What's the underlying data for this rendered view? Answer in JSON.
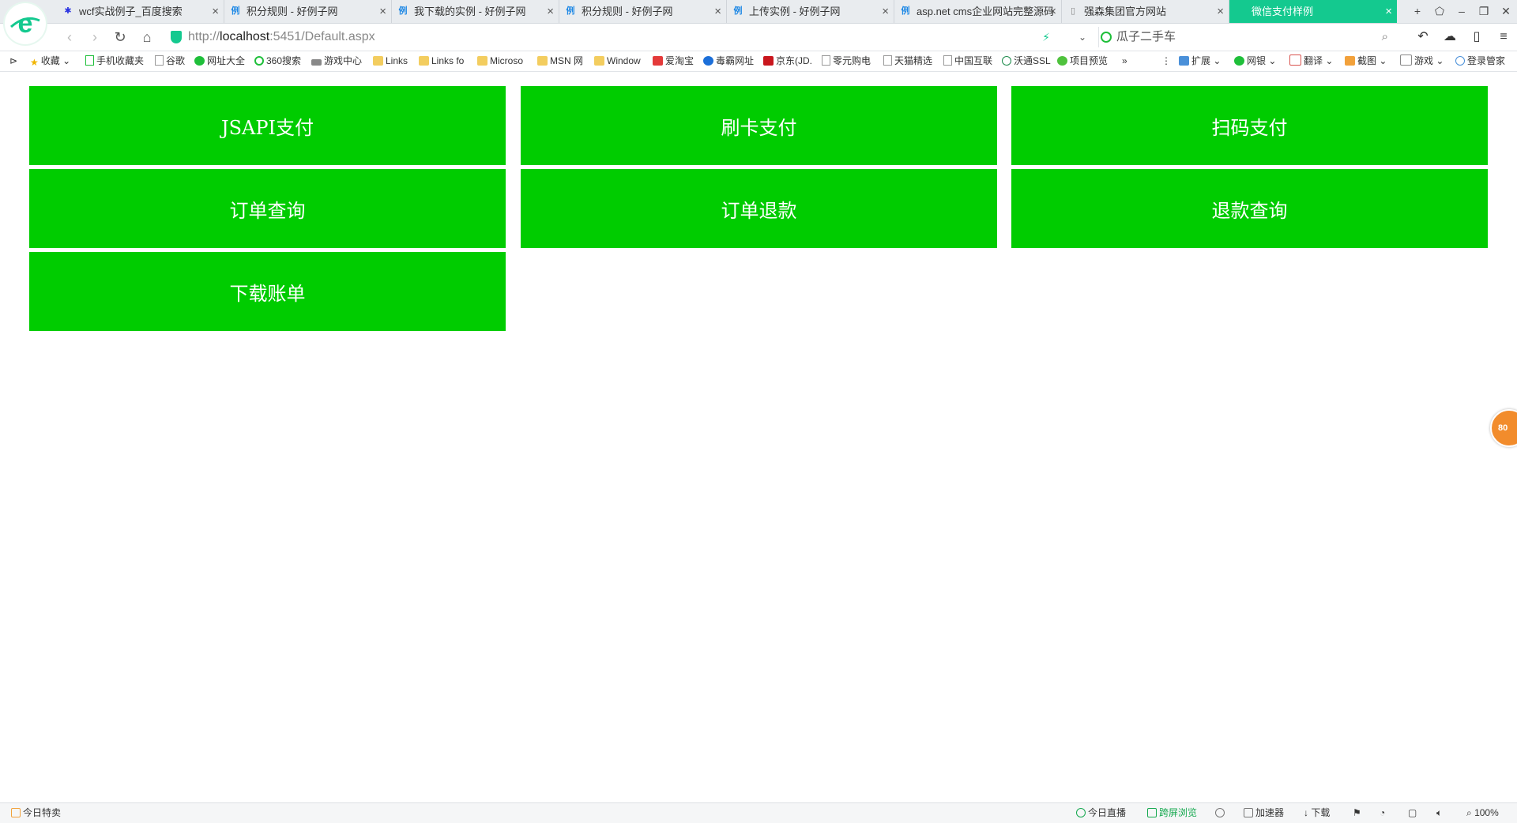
{
  "browser": {
    "tabs": [
      {
        "title": "wcf实战例子_百度搜索",
        "icon": "baidu-paw-icon",
        "icon_color": "#2932e1"
      },
      {
        "title": "积分规则 - 好例子网",
        "icon": "haolizi-icon",
        "icon_color": "#1e88e5"
      },
      {
        "title": "我下载的实例 - 好例子网",
        "icon": "haolizi-icon",
        "icon_color": "#1e88e5"
      },
      {
        "title": "积分规则 - 好例子网",
        "icon": "haolizi-icon",
        "icon_color": "#1e88e5"
      },
      {
        "title": "上传实例 - 好例子网",
        "icon": "haolizi-icon",
        "icon_color": "#1e88e5"
      },
      {
        "title": "asp.net cms企业网站完整源码",
        "icon": "haolizi-icon",
        "icon_color": "#1e88e5"
      },
      {
        "title": "强森集团官方网站",
        "icon": "page-icon",
        "icon_color": "#888888"
      },
      {
        "title": "微信支付样例",
        "icon": "none",
        "icon_color": "#ffffff",
        "active": true
      }
    ],
    "url_scheme": "http://",
    "url_host": "localhost",
    "url_rest": ":5451/Default.aspx",
    "search_text": "瓜子二手车",
    "bookmarks": [
      {
        "label": "收藏",
        "icon": "star-icon"
      },
      {
        "label": "手机收藏夹",
        "icon": "phone-icon"
      },
      {
        "label": "谷歌",
        "icon": "page-icon"
      },
      {
        "label": "网址大全",
        "icon": "site-icon"
      },
      {
        "label": "360搜索",
        "icon": "search360-icon"
      },
      {
        "label": "游戏中心",
        "icon": "gamepad-icon"
      },
      {
        "label": "Links",
        "icon": "folder-icon"
      },
      {
        "label": "Links fo",
        "icon": "folder-icon"
      },
      {
        "label": "Microso",
        "icon": "folder-icon"
      },
      {
        "label": "MSN 网",
        "icon": "folder-icon"
      },
      {
        "label": "Window",
        "icon": "folder-icon"
      },
      {
        "label": "爱淘宝",
        "icon": "taobao-icon"
      },
      {
        "label": "毒霸网址",
        "icon": "duba-icon"
      },
      {
        "label": "京东(JD.",
        "icon": "jd-icon"
      },
      {
        "label": "零元购电",
        "icon": "page-icon"
      },
      {
        "label": "天猫精选",
        "icon": "page-icon"
      },
      {
        "label": "中国互联",
        "icon": "page-icon"
      },
      {
        "label": "沃通SSL",
        "icon": "ssl-icon"
      },
      {
        "label": "项目预览",
        "icon": "wechat-icon"
      }
    ],
    "more_label": "»",
    "right_tools": [
      {
        "label": "扩展",
        "icon": "extension-icon"
      },
      {
        "label": "网银",
        "icon": "bank-icon"
      },
      {
        "label": "翻译",
        "icon": "translate-icon"
      },
      {
        "label": "截图",
        "icon": "screenshot-icon"
      },
      {
        "label": "游戏",
        "icon": "game-icon"
      },
      {
        "label": "登录管家",
        "icon": "login-icon"
      }
    ]
  },
  "page": {
    "buttons": [
      {
        "label": "JSAPI支付"
      },
      {
        "label": "刷卡支付"
      },
      {
        "label": "扫码支付"
      },
      {
        "label": "订单查询"
      },
      {
        "label": "订单退款"
      },
      {
        "label": "退款查询"
      },
      {
        "label": "下载账单"
      }
    ],
    "button_color": "#00cc00",
    "float_ball_text": "80"
  },
  "statusbar": {
    "left": "今日特卖",
    "items": [
      "今日直播",
      "跨屏浏览",
      "",
      "加速器",
      "下载",
      "",
      "",
      "",
      ""
    ],
    "zoom": "100%"
  }
}
